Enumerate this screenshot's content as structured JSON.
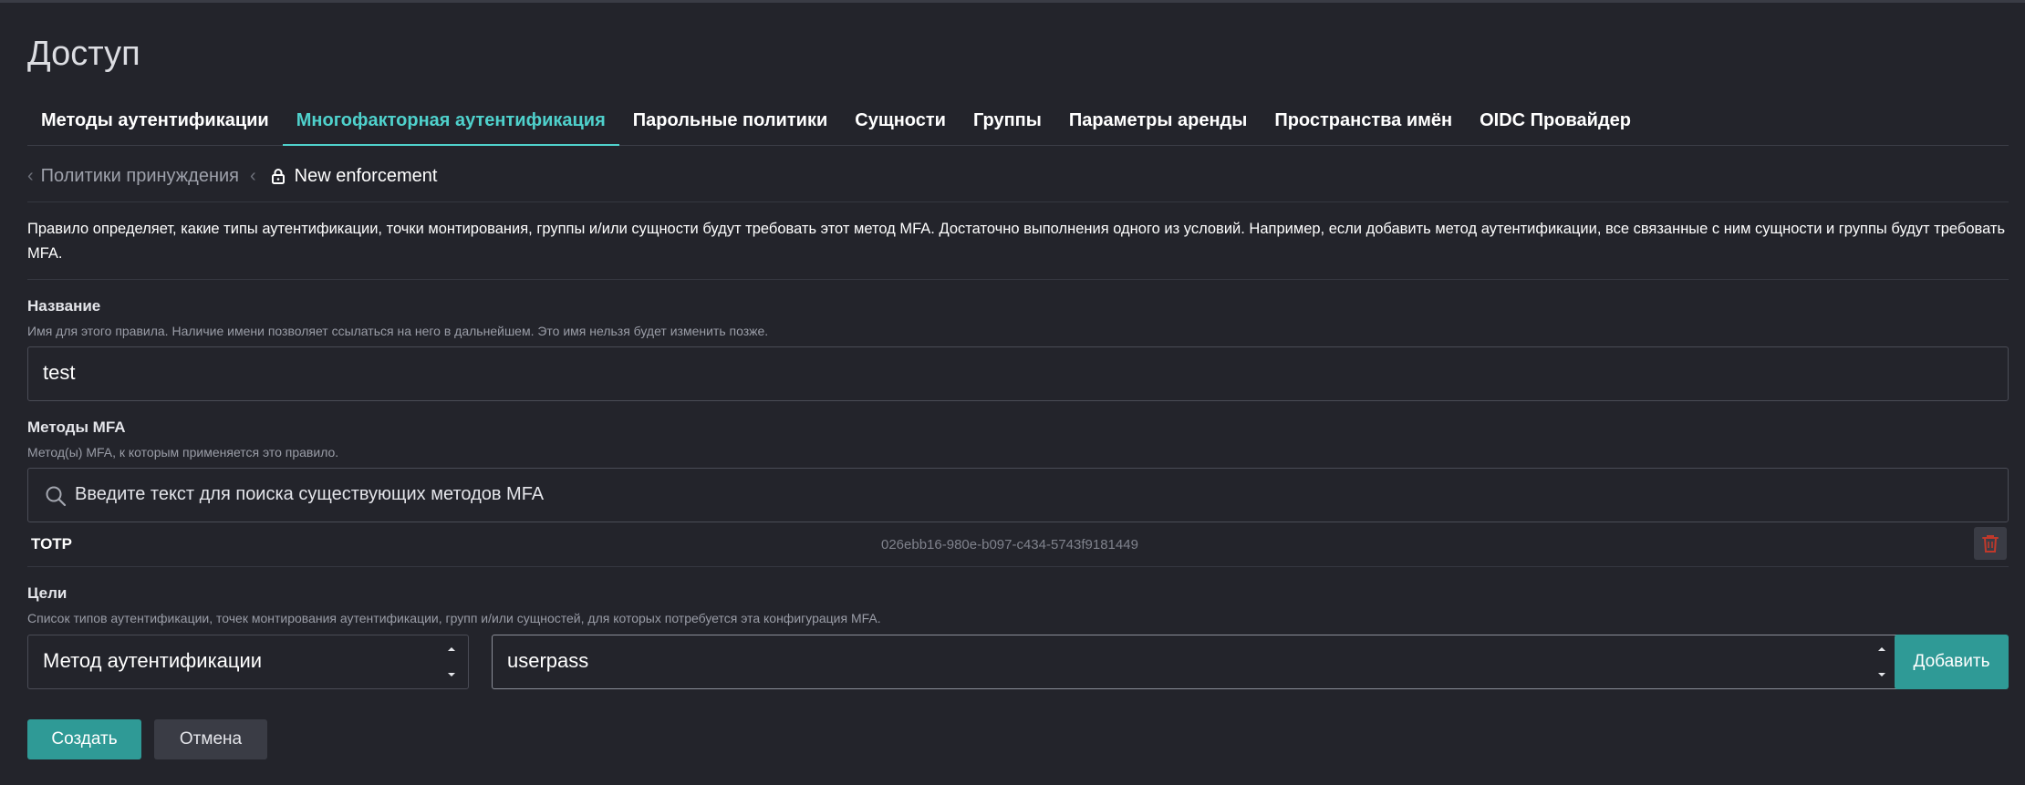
{
  "page": {
    "title": "Доступ"
  },
  "tabs": [
    {
      "label": "Методы аутентификации",
      "active": false
    },
    {
      "label": "Многофакторная аутентификация",
      "active": true
    },
    {
      "label": "Парольные политики",
      "active": false
    },
    {
      "label": "Сущности",
      "active": false
    },
    {
      "label": "Группы",
      "active": false
    },
    {
      "label": "Параметры аренды",
      "active": false
    },
    {
      "label": "Пространства имён",
      "active": false
    },
    {
      "label": "OIDC Провайдер",
      "active": false
    }
  ],
  "breadcrumb": {
    "parent": "Политики принуждения",
    "current": "New enforcement",
    "icon": "lock-icon"
  },
  "description": "Правило определяет, какие типы аутентификации, точки монтирования, группы и/или сущности будут требовать этот метод MFA. Достаточно выполнения одного из условий. Например, если добавить метод аутентификации, все связанные с ним сущности и группы будут требовать MFA.",
  "name_field": {
    "label": "Название",
    "help": "Имя для этого правила. Наличие имени позволяет ссылаться на него в дальнейшем. Это имя нельзя будет изменить позже.",
    "value": "test"
  },
  "mfa_methods": {
    "label": "Методы MFA",
    "help": "Метод(ы) MFA, к которым применяется это правило.",
    "search_placeholder": "Введите текст для поиска существующих методов MFA",
    "items": [
      {
        "name": "TOTP",
        "id": "026ebb16-980e-b097-c434-5743f9181449"
      }
    ]
  },
  "targets": {
    "label": "Цели",
    "help": "Список типов аутентификации, точек монтирования аутентификации, групп и/или сущностей, для которых потребуется эта конфигурация MFA.",
    "type_select": "Метод аутентификации",
    "value_select": "userpass",
    "add_label": "Добавить"
  },
  "actions": {
    "create_label": "Создать",
    "cancel_label": "Отмена"
  },
  "colors": {
    "accent": "#4fd1cc",
    "primary_button": "#2f9a96",
    "background": "#23242b",
    "danger": "#c0392b"
  }
}
